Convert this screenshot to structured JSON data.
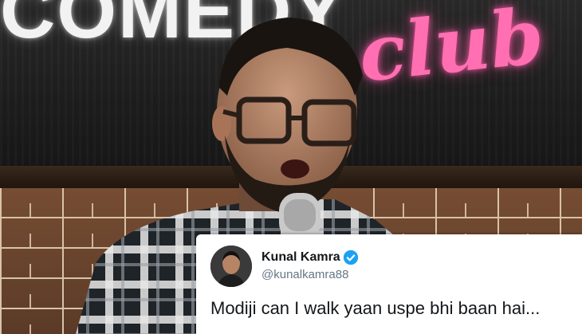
{
  "photo": {
    "sign_text_white": "COMEDY",
    "sign_text_pink": "club",
    "sign_pink_color": "#ff6fb1"
  },
  "tweet": {
    "display_name": "Kunal Kamra",
    "handle": "@kunalkamra88",
    "verified_icon": "verified-badge-icon",
    "verified_color": "#1da1f2",
    "text": "Modiji can I walk yaan uspe bhi baan hai..."
  }
}
